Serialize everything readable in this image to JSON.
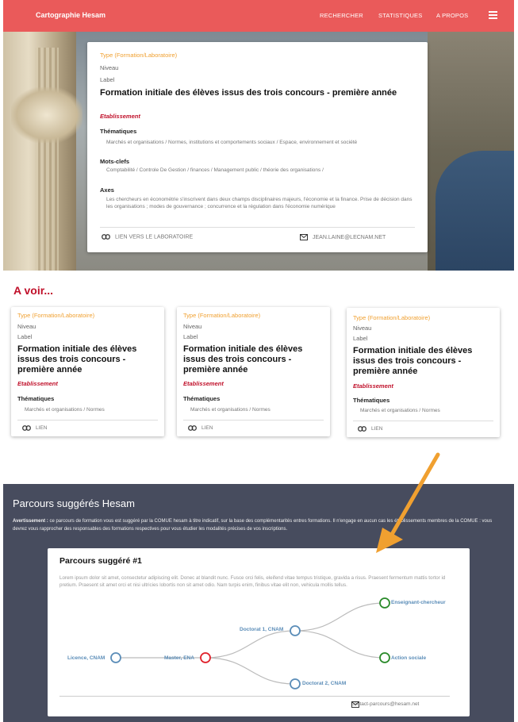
{
  "navbar": {
    "brand": "Cartographie Hesam",
    "items": [
      "RECHERCHER",
      "STATISTIQUES",
      "A PROPOS"
    ],
    "menu_icon": "hamburger-menu-icon"
  },
  "main_card": {
    "type": "Type (Formation/Laboratoire)",
    "niveau": "Niveau",
    "label": "Label",
    "title": "Formation initiale des élèves issus des trois concours - première année",
    "etablissement": "Etablissement",
    "thematiques_heading": "Thématiques",
    "thematiques": "Marchés et organisations / Normes, institutions et comportements sociaux / Espace, environnement et société",
    "motscles_heading": "Mots-clefs",
    "motscles": "Comptabilité / Controle De Gestion / finances / Management public / théorie des organisations /",
    "axes_heading": "Axes",
    "axes": "Les chercheurs en économétrie s'inscrivent dans deux champs disciplinaires majeurs, l'économie et la finance. Prise de décision dans les organisations ; modes de gouvernance ; concurrence et la régulation dans l'économie numérique",
    "link_label": "LIEN VERS LE LABORATOIRE",
    "email": "JEAN.LAINE@LECNAM.NET"
  },
  "avoir": {
    "heading": "A voir...",
    "cards": [
      {
        "type": "Type (Formation/Laboratoire)",
        "niveau": "Niveau",
        "label": "Label",
        "title": "Formation initiale des élèves issus des trois concours - première année",
        "etablissement": "Etablissement",
        "thematiques_heading": "Thématiques",
        "thematiques": "Marchés et organisations / Normes",
        "link": "LIEN"
      },
      {
        "type": "Type (Formation/Laboratoire)",
        "niveau": "Niveau",
        "label": "Label",
        "title": "Formation initiale des élèves issus des trois concours - première année",
        "etablissement": "Etablissement",
        "thematiques_heading": "Thématiques",
        "thematiques": "Marchés et organisations / Normes",
        "link": "LIEN"
      },
      {
        "type": "Type (Formation/Laboratoire)",
        "niveau": "Niveau",
        "label": "Label",
        "title": "Formation initiale des élèves issus des trois concours - première année",
        "etablissement": "Etablissement",
        "thematiques_heading": "Thématiques",
        "thematiques": "Marchés et organisations / Normes",
        "link": "LIEN"
      }
    ]
  },
  "parcours": {
    "heading": "Parcours suggérés Hesam",
    "warning_label": "Avertissement :",
    "warning_text": " ce parcours de formation vous est suggéré par la COMUE hesam à titre indicatif, sur la base des complémentarités entres formations. Il n'engage en aucun cas les établissements membres de la COMUE : vous devrez vous rapprocher des responsables des formations respectives pour vous étudier les modalités précises de vos inscriptions.",
    "card_title": "Parcours suggéré #1",
    "lorem": "Lorem ipsum dolor sit amet, consectetur adipiscing elit. Donec at blandit nunc. Fusce orci felis, eleifend vitae tempus tristique, gravida a risus. Praesent fermentum mattis tortor id pretium. Praesent sit amet orci et nisi ultricies lobortis non sit amet odio. Nam turpis enim, finibus vitae elit non, vehicula mollis tellus.",
    "nodes": [
      {
        "id": "licence",
        "label": "Licence, CNAM",
        "color": "#5b8db8"
      },
      {
        "id": "master",
        "label": "Master, ENA",
        "color": "#e0202a"
      },
      {
        "id": "doctorat1",
        "label": "Doctorat 1, CNAM",
        "color": "#5b8db8"
      },
      {
        "id": "doctorat2",
        "label": "Doctorat 2, CNAM",
        "color": "#5b8db8"
      },
      {
        "id": "enseignant",
        "label": "Enseignant-chercheur",
        "color": "#2a8a2a"
      },
      {
        "id": "action",
        "label": "Action sociale",
        "color": "#2a8a2a"
      }
    ],
    "edges": [
      [
        "licence",
        "master"
      ],
      [
        "master",
        "doctorat1"
      ],
      [
        "master",
        "doctorat2"
      ],
      [
        "doctorat1",
        "enseignant"
      ],
      [
        "doctorat1",
        "action"
      ]
    ],
    "contact": "contact-parcours@hesam.net"
  },
  "colors": {
    "navbar": "#ea5a5a",
    "accent_red": "#c0102a",
    "type_orange": "#f0a030",
    "parcours_bg": "#474c5e",
    "arrow": "#f0a030"
  }
}
